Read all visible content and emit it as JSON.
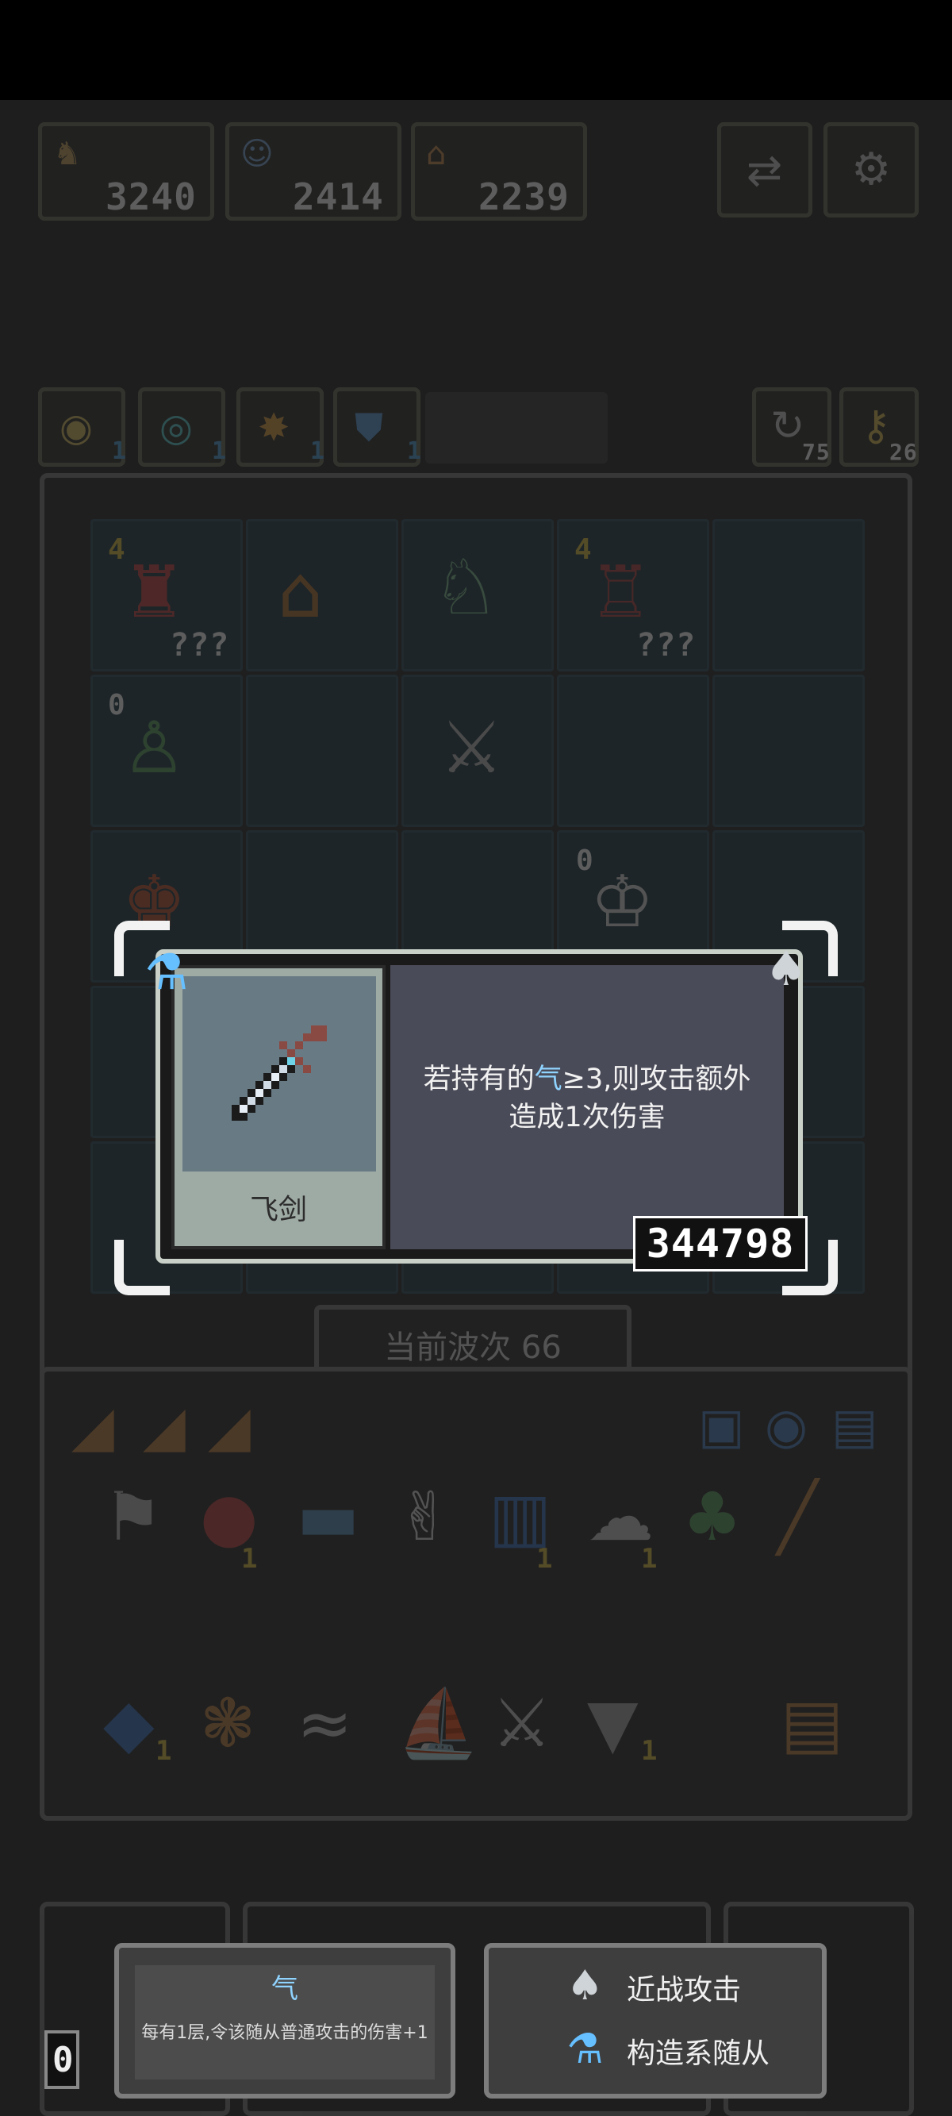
{
  "top_bar": {
    "resources": [
      {
        "icon": "hero-icon",
        "value": "3240"
      },
      {
        "icon": "merchant-icon",
        "value": "2414"
      },
      {
        "icon": "hut-icon",
        "value": "2239"
      }
    ],
    "buttons": [
      {
        "icon": "swap-icon"
      },
      {
        "icon": "settings-icon"
      }
    ]
  },
  "buffs": [
    {
      "icon": "eye-buff-icon",
      "count": "1"
    },
    {
      "icon": "target-buff-icon",
      "count": "1"
    },
    {
      "icon": "burst-buff-icon",
      "count": "1"
    },
    {
      "icon": "shield-buff-icon",
      "count": "1"
    }
  ],
  "right_counters": [
    {
      "icon": "refresh-icon",
      "value": "75"
    },
    {
      "icon": "key-icon",
      "value": "26"
    }
  ],
  "board": {
    "units": [
      {
        "label": "4",
        "value": "???"
      },
      {
        "label": "",
        "value": ""
      },
      {
        "label": "",
        "value": ""
      },
      {
        "label": "4",
        "value": "???"
      },
      {
        "label": "0",
        "value": ""
      },
      {
        "label": "0",
        "value": ""
      }
    ]
  },
  "wave": {
    "label": "当前波次 66"
  },
  "tooltip": {
    "item_name": "飞剑",
    "desc_line1_pre": "若持有的",
    "desc_line1_key": "气",
    "desc_line1_post": "≥3,则攻击额外",
    "desc_line2": "造成1次伤害",
    "power": "344798",
    "key_color": "#8fd3ff"
  },
  "inventory": {
    "counts": [
      "1",
      "1",
      "1",
      "1",
      "1"
    ]
  },
  "footer": {
    "qi_title": "气",
    "qi_desc": "每有1层,令该随从普通攻击的伤害+1",
    "tag1": "近战攻击",
    "tag2": "构造系随从",
    "left_number": "0"
  }
}
